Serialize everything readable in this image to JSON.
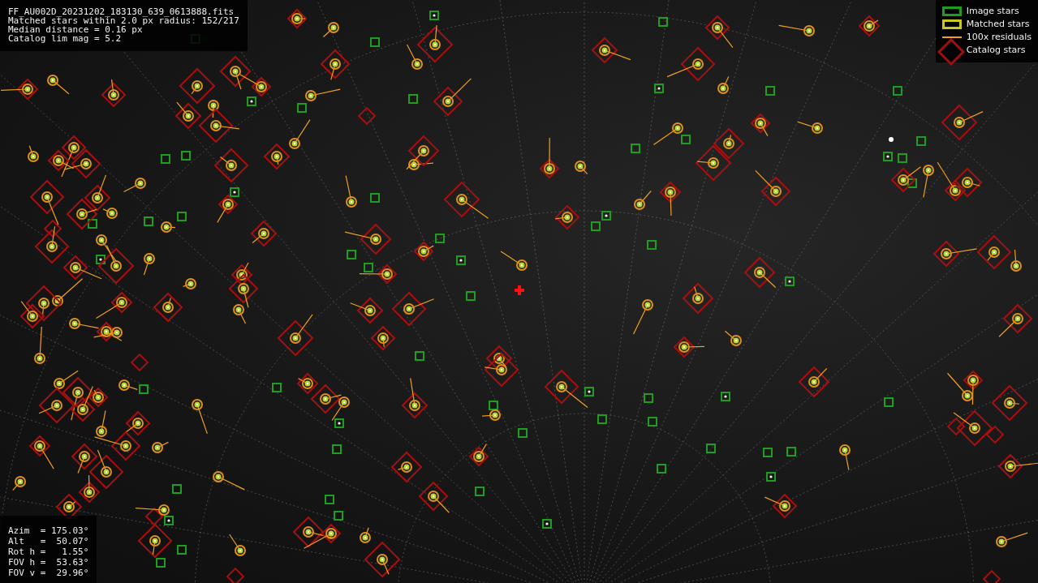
{
  "info_panel": {
    "lines": [
      "FF_AU002D_20231202_183130_639_0613888.fits",
      "Matched stars within 2.0 px radius: 152/217",
      "Median distance = 0.16 px",
      "Catalog lim mag = 5.2"
    ]
  },
  "legend": [
    {
      "kind": "image",
      "label": "Image stars",
      "color": "#1e9e1e"
    },
    {
      "kind": "matched",
      "label": "Matched stars",
      "color": "#c8c81e"
    },
    {
      "kind": "residual",
      "label": "100x residuals",
      "color": "#f0a020"
    },
    {
      "kind": "catalog",
      "label": "Catalog stars",
      "color": "#a01010"
    }
  ],
  "pointing_panel": {
    "lines": [
      "Azim  = 175.03°",
      "Alt   =  50.07°",
      "Rot h =   1.55°",
      "FOV h =  53.63°",
      "FOV v =  29.96°"
    ]
  }
}
